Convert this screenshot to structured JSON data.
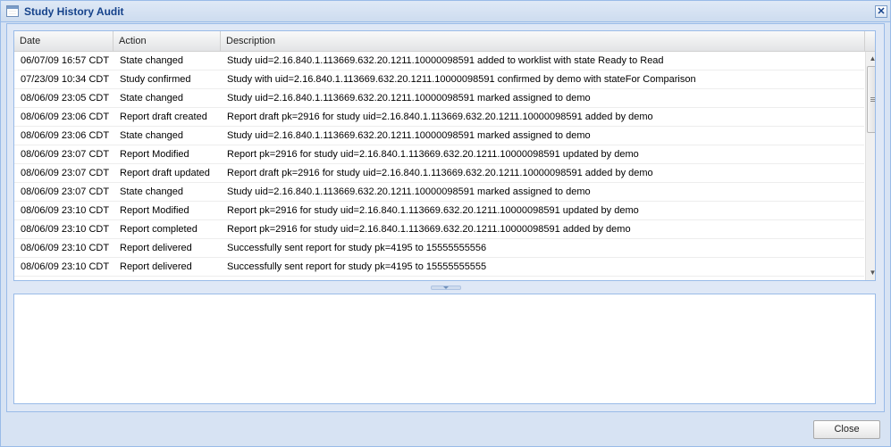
{
  "window": {
    "title": "Study History Audit",
    "close_glyph": "✕"
  },
  "grid": {
    "columns": [
      "Date",
      "Action",
      "Description"
    ],
    "rows": [
      {
        "date": "06/07/09 16:57 CDT",
        "action": "State changed",
        "description": "Study uid=2.16.840.1.113669.632.20.1211.10000098591 added to worklist with state Ready to Read"
      },
      {
        "date": "07/23/09 10:34 CDT",
        "action": "Study confirmed",
        "description": "Study with uid=2.16.840.1.113669.632.20.1211.10000098591 confirmed by demo with stateFor Comparison"
      },
      {
        "date": "08/06/09 23:05 CDT",
        "action": "State changed",
        "description": "Study uid=2.16.840.1.113669.632.20.1211.10000098591 marked assigned to demo"
      },
      {
        "date": "08/06/09 23:06 CDT",
        "action": "Report draft created",
        "description": "Report draft pk=2916 for study uid=2.16.840.1.113669.632.20.1211.10000098591 added by demo"
      },
      {
        "date": "08/06/09 23:06 CDT",
        "action": "State changed",
        "description": "Study uid=2.16.840.1.113669.632.20.1211.10000098591 marked assigned to demo"
      },
      {
        "date": "08/06/09 23:07 CDT",
        "action": "Report Modified",
        "description": "Report pk=2916 for study uid=2.16.840.1.113669.632.20.1211.10000098591 updated by demo"
      },
      {
        "date": "08/06/09 23:07 CDT",
        "action": "Report draft updated",
        "description": "Report draft pk=2916 for study uid=2.16.840.1.113669.632.20.1211.10000098591 added by demo"
      },
      {
        "date": "08/06/09 23:07 CDT",
        "action": "State changed",
        "description": "Study uid=2.16.840.1.113669.632.20.1211.10000098591 marked assigned to demo"
      },
      {
        "date": "08/06/09 23:10 CDT",
        "action": "Report Modified",
        "description": "Report pk=2916 for study uid=2.16.840.1.113669.632.20.1211.10000098591 updated by demo"
      },
      {
        "date": "08/06/09 23:10 CDT",
        "action": "Report completed",
        "description": "Report pk=2916 for study uid=2.16.840.1.113669.632.20.1211.10000098591 added by demo"
      },
      {
        "date": "08/06/09 23:10 CDT",
        "action": "Report delivered",
        "description": "Successfully sent report for study pk=4195 to 15555555556"
      },
      {
        "date": "08/06/09 23:10 CDT",
        "action": "Report delivered",
        "description": "Successfully sent report for study pk=4195 to 15555555555"
      }
    ]
  },
  "scrollbar": {
    "up_glyph": "▲",
    "down_glyph": "▼"
  },
  "footer": {
    "close_label": "Close"
  },
  "icons": {
    "window": "table-icon",
    "close": "close-icon",
    "splitter": "collapse-arrow-icon"
  },
  "colors": {
    "title_text": "#15428b",
    "panel_border": "#99bbe8",
    "panel_background": "#dfe8f6"
  }
}
